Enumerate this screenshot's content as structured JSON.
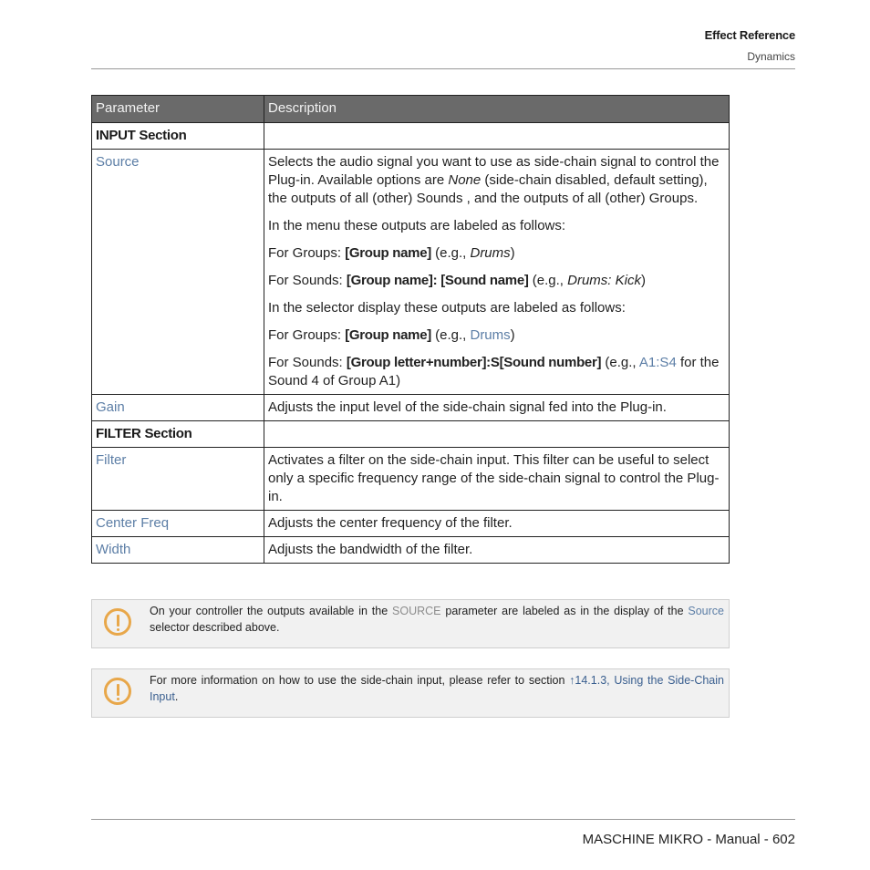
{
  "header": {
    "chapter": "Effect Reference",
    "section": "Dynamics"
  },
  "table": {
    "columns": [
      "Parameter",
      "Description"
    ],
    "input_section": "INPUT Section",
    "source": {
      "name": "Source",
      "p1_a": "Selects the audio signal you want to use as side-chain signal to control the Plug-in. Available options are ",
      "p1_none": "None",
      "p1_b": " (side-chain disabled, default setting), the outputs of all (other) Sounds , and the outputs of all (other) Groups.",
      "p2": "In the menu these outputs are labeled as follows:",
      "p3_a": "For Groups: ",
      "p3_b": "[Group name]",
      "p3_c": " (e.g., ",
      "p3_d": "Drums",
      "p3_e": ")",
      "p4_a": "For Sounds: ",
      "p4_b": "[Group name]: [Sound name]",
      "p4_c": " (e.g., ",
      "p4_d": "Drums: Kick",
      "p4_e": ")",
      "p5": "In the selector display these outputs are labeled as follows:",
      "p6_a": "For Groups: ",
      "p6_b": "[Group name]",
      "p6_c": " (e.g., ",
      "p6_d": "Drums",
      "p6_e": ")",
      "p7_a": "For Sounds: ",
      "p7_b": "[Group letter+number]:S[Sound number]",
      "p7_c": " (e.g., ",
      "p7_d": "A1:S4",
      "p7_e": " for the Sound 4 of Group A1)"
    },
    "gain": {
      "name": "Gain",
      "desc": "Adjusts the input level of the side-chain signal fed into the Plug-in."
    },
    "filter_section": "FILTER Section",
    "filter": {
      "name": "Filter",
      "desc": "Activates a filter on the side-chain input. This filter can be useful to select only a specific frequency range of the side-chain signal to control the Plug-in."
    },
    "center_freq": {
      "name": "Center Freq",
      "desc": "Adjusts the center frequency of the filter."
    },
    "width": {
      "name": "Width",
      "desc": "Adjusts the bandwidth of the filter."
    }
  },
  "notes": [
    {
      "icon": "warning-icon",
      "a": "On your controller the outputs available in the ",
      "b": "SOURCE",
      "c": " parameter are labeled as in the display of the ",
      "d": "Source",
      "e": " selector described above."
    },
    {
      "icon": "warning-icon",
      "a": "For more information on how to use the side-chain input, please refer to section ",
      "link": "↑14.1.3, Using the Side-Chain Input",
      "e": "."
    }
  ],
  "footer": {
    "text": "MASCHINE MIKRO - Manual - 602"
  },
  "colors": {
    "header_bg": "#6a6a6a",
    "param_link": "#5c7ea6",
    "xref": "#3a5f8f",
    "warning": "#e8a74a",
    "note_bg": "#f1f1f1"
  }
}
